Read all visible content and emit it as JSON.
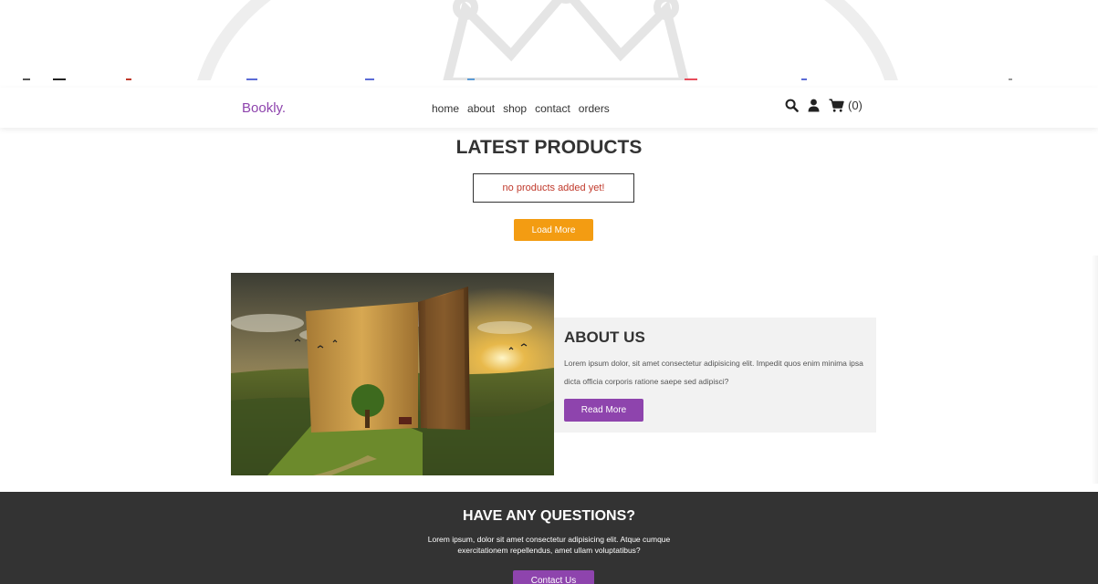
{
  "header": {
    "logo": "Bookly.",
    "nav": [
      "home",
      "about",
      "shop",
      "contact",
      "orders"
    ],
    "cart_count": "(0)",
    "icons": [
      "search-icon",
      "user-icon",
      "cart-icon"
    ]
  },
  "latest": {
    "title": "LATEST PRODUCTS",
    "empty_message": "no products added yet!",
    "load_more_label": "Load More"
  },
  "about": {
    "title": "ABOUT US",
    "text": "Lorem ipsum dolor, sit amet consectetur adipisicing elit. Impedit quos enim minima ipsa dicta officia corporis ratione saepe sed adipisci?",
    "read_more_label": "Read More"
  },
  "questions": {
    "title": "HAVE ANY QUESTIONS?",
    "text_line1": "Lorem ipsum, dolor sit amet consectetur adipisicing elit. Atque cumque",
    "text_line2": "exercitationem repellendus, amet ullam voluptatibus?",
    "contact_label": "Contact Us"
  },
  "colors": {
    "brand": "#8e44ad",
    "accent": "#f39c12",
    "error": "#c0392b",
    "dark": "#333333"
  }
}
